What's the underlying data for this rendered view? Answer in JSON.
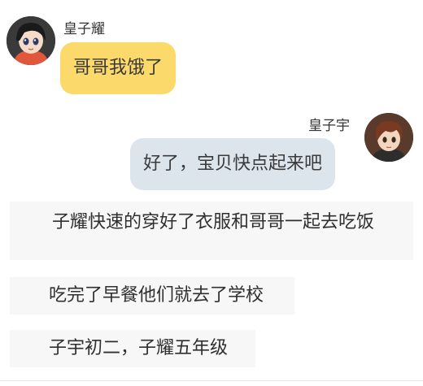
{
  "messages": [
    {
      "speaker": "皇子耀",
      "text": "哥哥我饿了"
    },
    {
      "speaker": "皇子宇",
      "text": "好了，宝贝快点起来吧"
    }
  ],
  "narration": [
    "子耀快速的穿好了衣服和哥哥一起去吃饭",
    "吃完了早餐他们就去了学校",
    "子宇初二，子耀五年级"
  ],
  "colors": {
    "left_bubble": "#fcd96b",
    "right_bubble": "#dde5ec",
    "narration_bg": "#f7f7f7"
  }
}
